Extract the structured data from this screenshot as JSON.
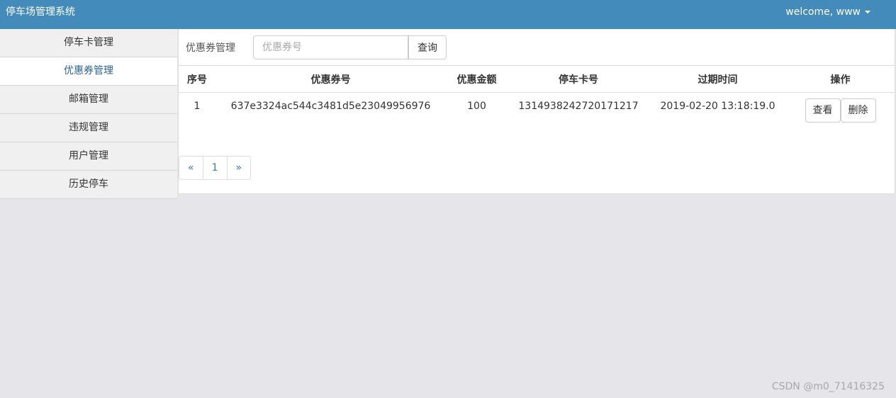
{
  "header": {
    "app_title": "停车场管理系统",
    "user_menu_label": "welcome, www"
  },
  "sidebar": {
    "items": [
      {
        "label": "停车卡管理",
        "active": false
      },
      {
        "label": "优惠券管理",
        "active": true
      },
      {
        "label": "邮箱管理",
        "active": false
      },
      {
        "label": "违规管理",
        "active": false
      },
      {
        "label": "用户管理",
        "active": false
      },
      {
        "label": "历史停车",
        "active": false
      }
    ]
  },
  "search": {
    "label": "优惠券管理",
    "placeholder": "优惠券号",
    "value": "",
    "button_label": "查询"
  },
  "table": {
    "columns": [
      "序号",
      "优惠券号",
      "优惠金额",
      "停车卡号",
      "过期时间",
      "操作"
    ],
    "rows": [
      {
        "index": "1",
        "coupon_no": "637e3324ac544c3481d5e23049956976",
        "amount": "100",
        "card_no": "1314938242720171217",
        "expire_time": "2019-02-20 13:18:19.0",
        "view_label": "查看",
        "delete_label": "删除"
      }
    ]
  },
  "pagination": {
    "prev": "«",
    "current": "1",
    "next": "»"
  },
  "watermark": "CSDN @m0_71416325",
  "colors": {
    "header_bg": "#428bba",
    "active_text": "#2a6496",
    "link": "#337ab7"
  },
  "icons": {
    "user_menu": "caret-down-icon"
  }
}
